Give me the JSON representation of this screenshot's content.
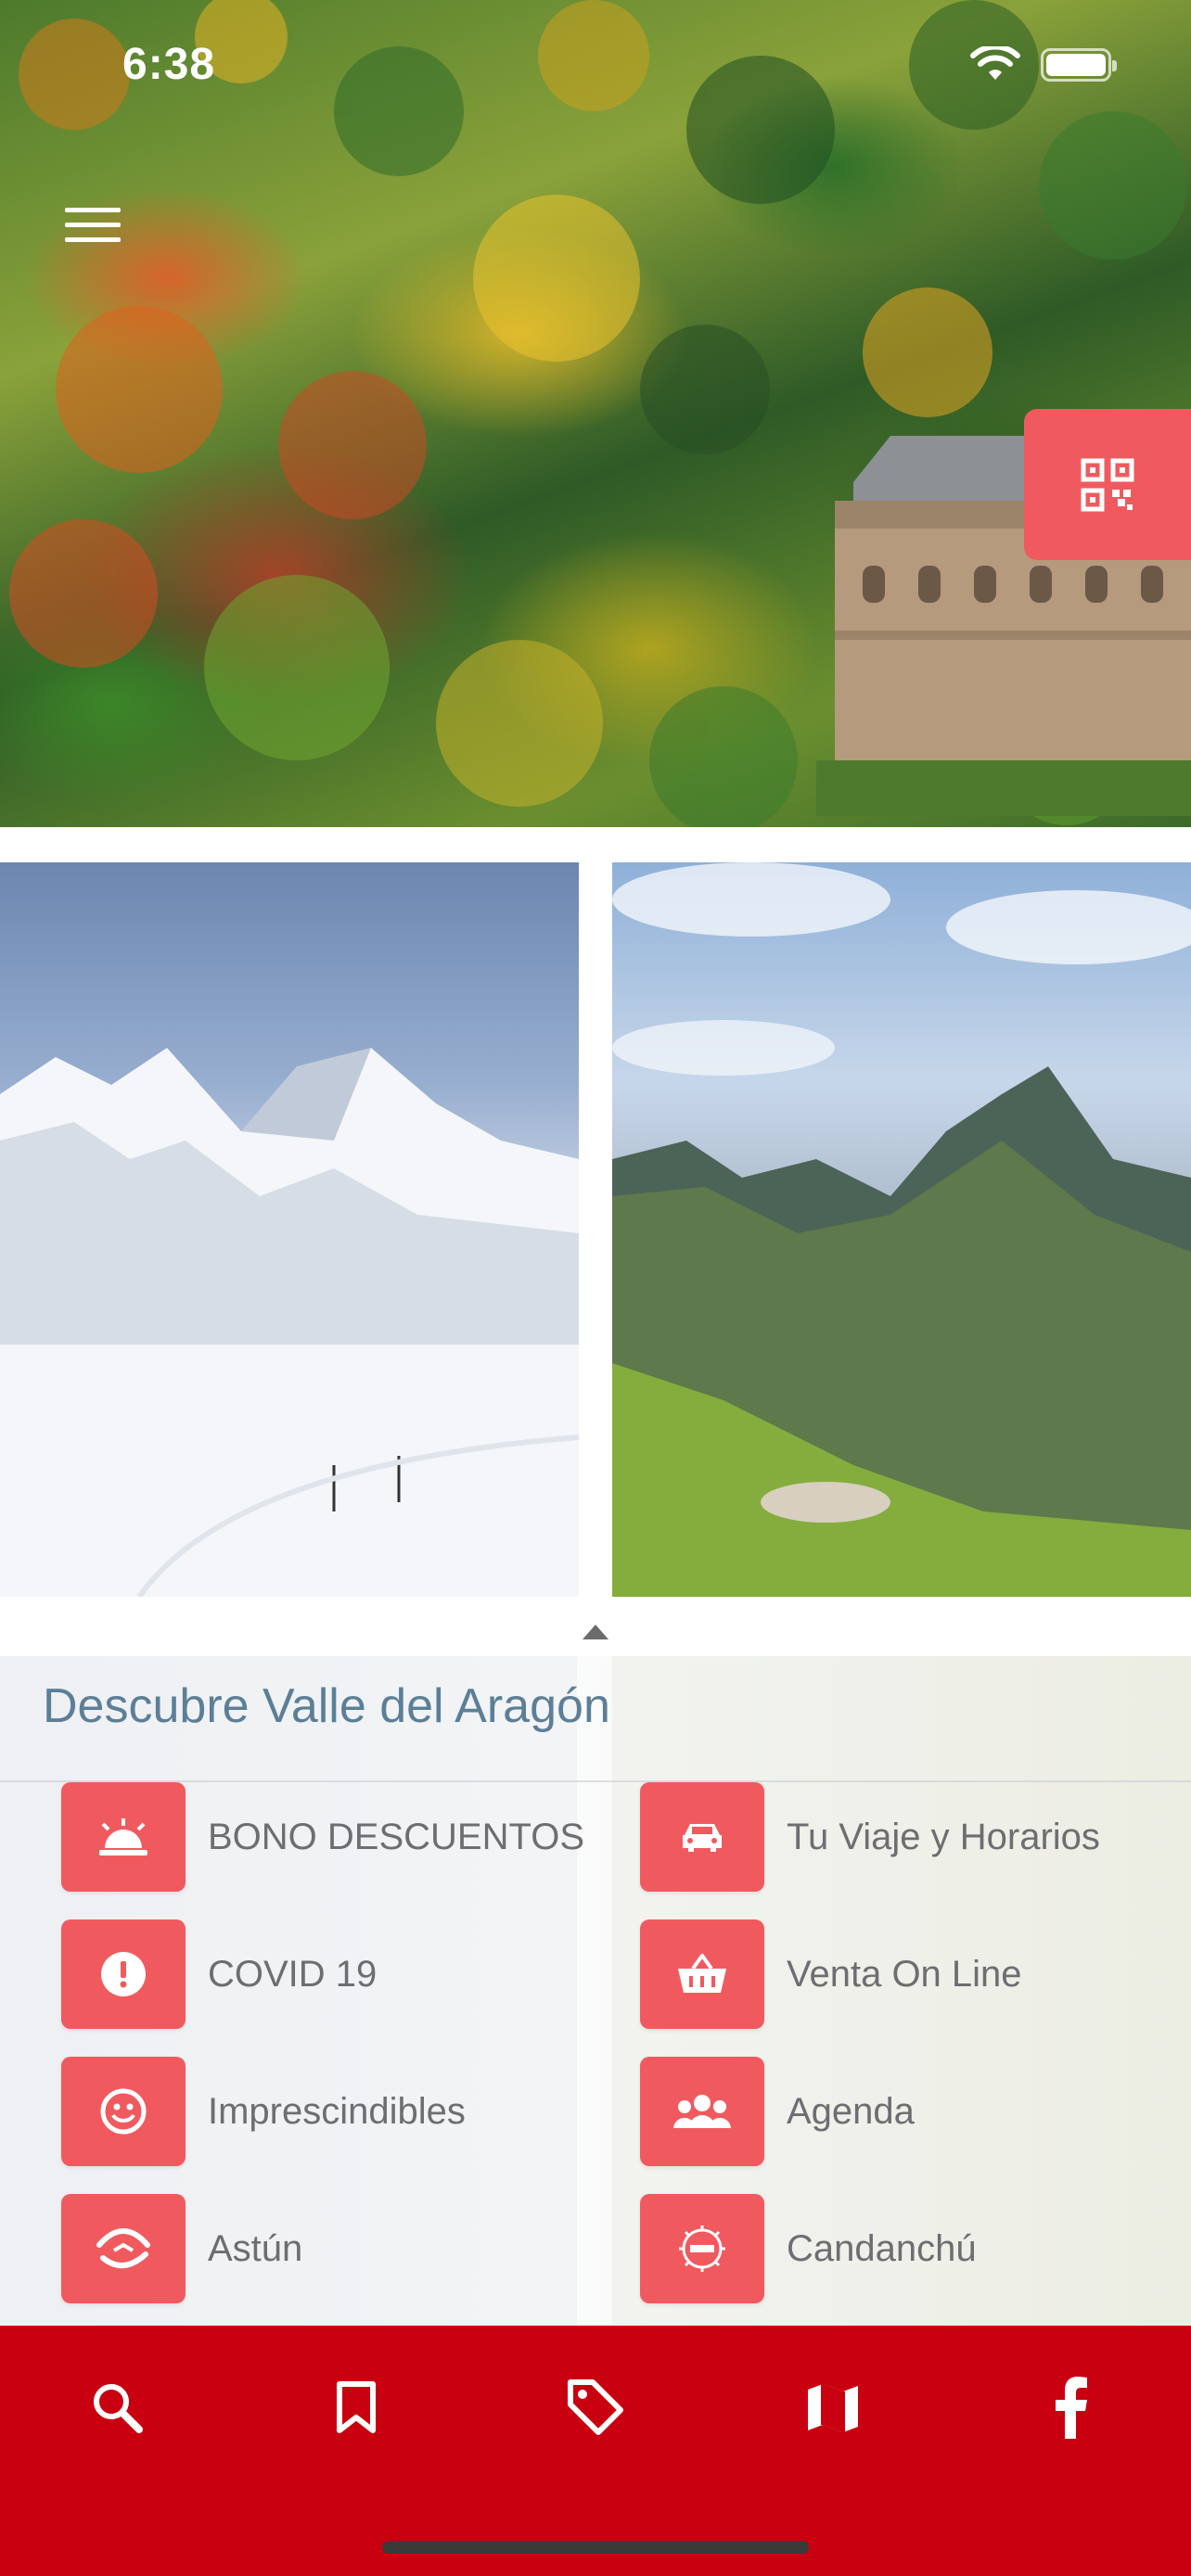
{
  "status_bar": {
    "time": "6:38"
  },
  "hero": {
    "menu_icon": "hamburger-menu-icon",
    "qr_icon": "qr-code-icon"
  },
  "panel": {
    "title": "Descubre Valle del Aragón",
    "items": [
      {
        "label": "BONO DESCUENTOS",
        "icon": "alarm-bell-icon"
      },
      {
        "label": "Tu Viaje y Horarios",
        "icon": "car-icon"
      },
      {
        "label": "COVID 19",
        "icon": "alert-icon"
      },
      {
        "label": "Venta On Line",
        "icon": "shopping-basket-icon"
      },
      {
        "label": "Imprescindibles",
        "icon": "smiley-icon"
      },
      {
        "label": "Agenda",
        "icon": "group-icon"
      },
      {
        "label": "Astún",
        "icon": "astun-logo-icon"
      },
      {
        "label": "Candanchú",
        "icon": "candanchu-logo-icon"
      }
    ]
  },
  "tab_bar": {
    "tabs": [
      "search-icon",
      "bookmark-icon",
      "tag-icon",
      "map-icon",
      "facebook-icon"
    ]
  },
  "colors": {
    "accent": "#f05a5f",
    "tab_bar": "#c90010",
    "title": "#5c7f97",
    "label": "#6d6e71"
  }
}
